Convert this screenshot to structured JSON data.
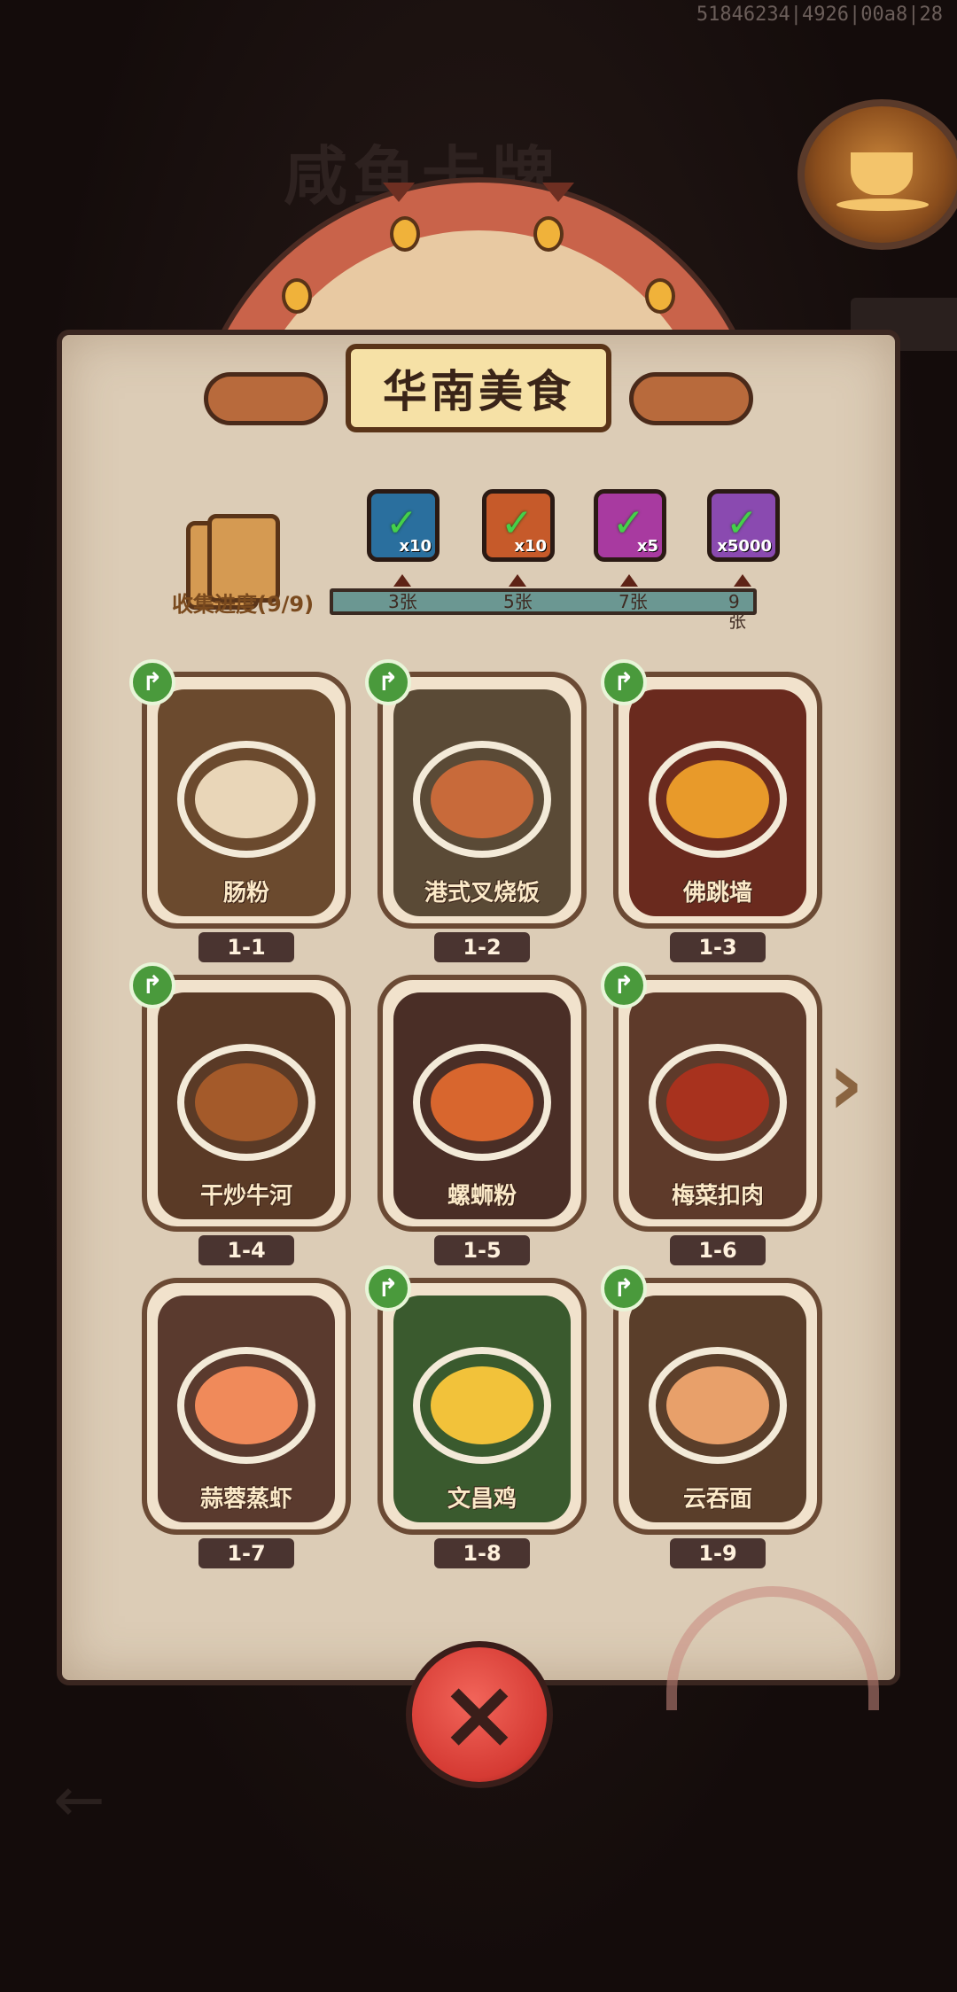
{
  "debug_id": "51846234|4926|00a8|28",
  "background_title": "咸鱼卡牌",
  "panel": {
    "title": "华南美食",
    "collection": {
      "label": "收集进度(9/9)",
      "collected": 9,
      "total": 9
    },
    "milestones": [
      {
        "label": "3张",
        "reward_qty": "x10",
        "reward_icon": "treasure-chest-icon",
        "reward_color": "#2a6f9e",
        "claimed": true
      },
      {
        "label": "5张",
        "reward_qty": "x10",
        "reward_icon": "ticket-icon",
        "reward_color": "#c65a2a",
        "claimed": true
      },
      {
        "label": "7张",
        "reward_qty": "x5",
        "reward_icon": "gem-orb-icon",
        "reward_color": "#a83aa0",
        "claimed": true
      },
      {
        "label": "9张",
        "reward_qty": "x5000",
        "reward_icon": "crystal-icon",
        "reward_color": "#8a4ab0",
        "claimed": true
      }
    ],
    "cards": [
      {
        "name": "肠粉",
        "level": "1-1",
        "shareable": true,
        "bg": "#6b4a2e",
        "food": "#e9d6b8"
      },
      {
        "name": "港式叉烧饭",
        "level": "1-2",
        "shareable": true,
        "bg": "#5a4a36",
        "food": "#c86a3a"
      },
      {
        "name": "佛跳墙",
        "level": "1-3",
        "shareable": true,
        "bg": "#6a2a1e",
        "food": "#e89a2a"
      },
      {
        "name": "干炒牛河",
        "level": "1-4",
        "shareable": true,
        "bg": "#5a3a26",
        "food": "#a45a2a"
      },
      {
        "name": "螺蛳粉",
        "level": "1-5",
        "shareable": false,
        "bg": "#4a2e26",
        "food": "#d8662e"
      },
      {
        "name": "梅菜扣肉",
        "level": "1-6",
        "shareable": true,
        "bg": "#5e3a2a",
        "food": "#a8321e"
      },
      {
        "name": "蒜蓉蒸虾",
        "level": "1-7",
        "shareable": false,
        "bg": "#5a3a2e",
        "food": "#f08a5a"
      },
      {
        "name": "文昌鸡",
        "level": "1-8",
        "shareable": true,
        "bg": "#3a5a2e",
        "food": "#f2c23a"
      },
      {
        "name": "云吞面",
        "level": "1-9",
        "shareable": true,
        "bg": "#5a3e2a",
        "food": "#e8a06a"
      }
    ]
  },
  "icons": {
    "share": "share-arrow-icon",
    "close": "close-x-icon",
    "next": "next-page-arrow-icon",
    "coffee": "coffee-cup-icon"
  }
}
